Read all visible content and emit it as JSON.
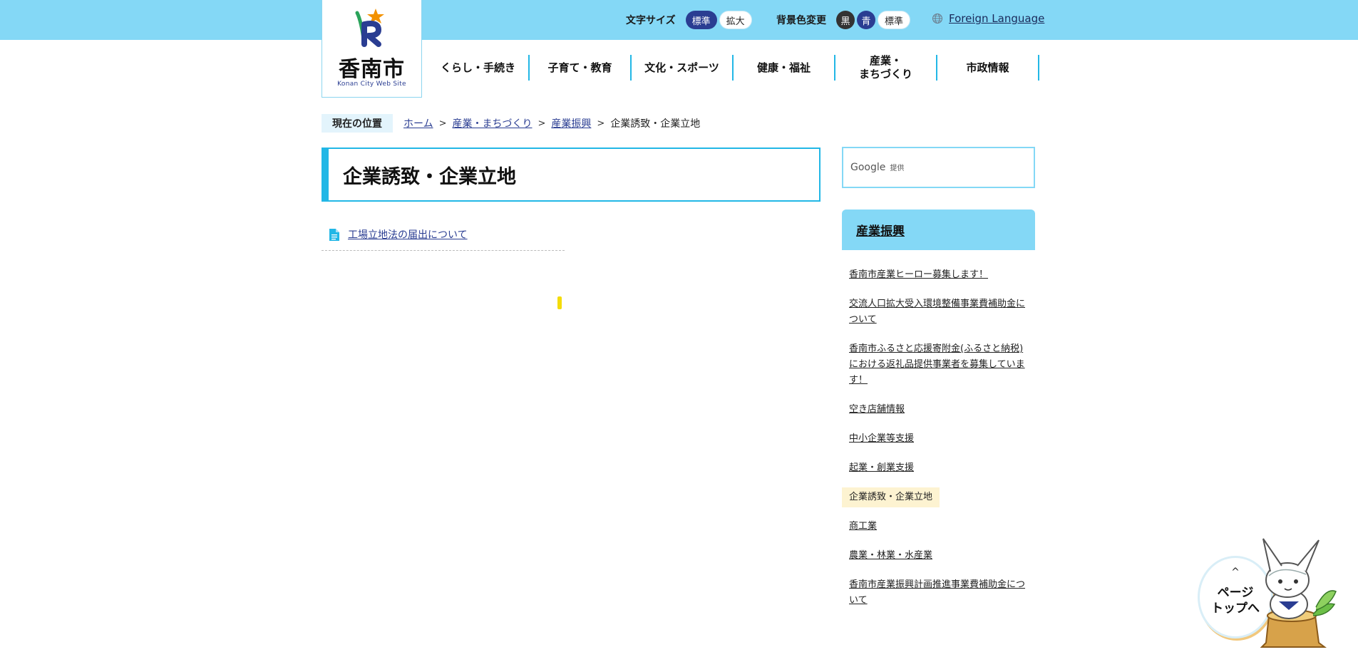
{
  "header": {
    "font_size_label": "文字サイズ",
    "font_size_options": [
      "標準",
      "拡大"
    ],
    "bg_color_label": "背景色変更",
    "bg_color_options": [
      "黒",
      "青",
      "標準"
    ],
    "foreign_language": "Foreign Language"
  },
  "logo": {
    "name": "香南市",
    "subtitle": "Konan City Web Site"
  },
  "nav": {
    "items": [
      "くらし・手続き",
      "子育て・教育",
      "文化・スポーツ",
      "健康・福祉",
      "産業・\nまちづくり",
      "市政情報"
    ]
  },
  "breadcrumb": {
    "label": "現在の位置",
    "items": [
      "ホーム",
      "産業・まちづくり",
      "産業振興"
    ],
    "current": "企業誘致・企業立地"
  },
  "page": {
    "title": "企業誘致・企業立地",
    "documents": [
      "工場立地法の届出について"
    ]
  },
  "search": {
    "brand": "Google",
    "brand_suffix": "提供"
  },
  "sidebar": {
    "heading": "産業振興",
    "items": [
      "香南市産業ヒーロー募集します！",
      "交流人口拡大受入環境整備事業費補助金について",
      "香南市ふるさと応援寄附金(ふるさと納税)における返礼品提供事業者を募集しています！",
      "空き店舗情報",
      "中小企業等支援",
      "起業・創業支援",
      "企業誘致・企業立地",
      "商工業",
      "農業・林業・水産業",
      "香南市産業振興計画推進事業費補助金について"
    ],
    "current_index": 6
  },
  "page_top": {
    "chevron": "^",
    "label_line1": "ページ",
    "label_line2": "トップへ"
  },
  "colors": {
    "topbar": "#84d8f6",
    "accent": "#22b7e6",
    "navy": "#2a3d92",
    "current_highlight": "#fdf3d1"
  }
}
